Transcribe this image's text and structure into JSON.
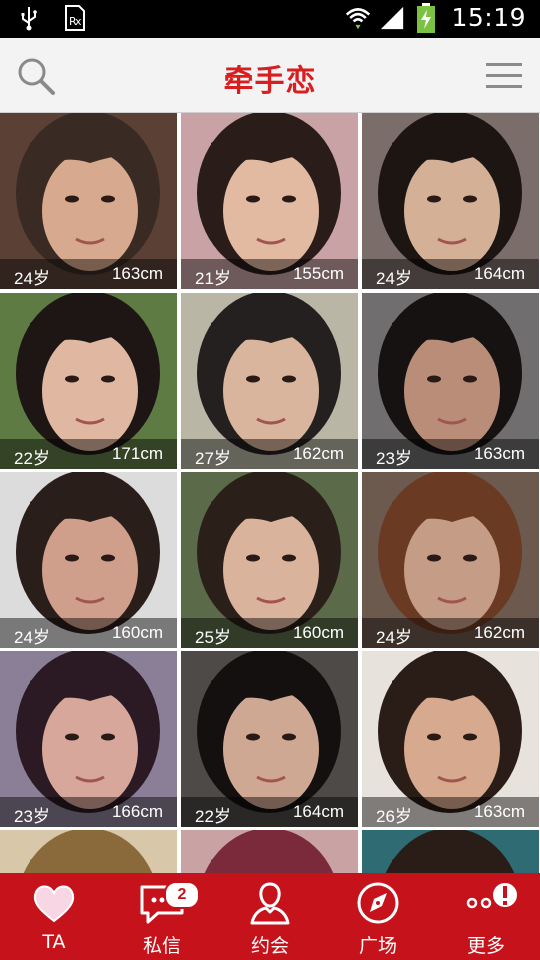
{
  "status_bar": {
    "time": "15:19",
    "icons": [
      "usb-icon",
      "sim-icon",
      "wifi-icon",
      "signal-icon",
      "battery-charging-icon"
    ]
  },
  "header": {
    "title": "牵手恋",
    "search_icon": "search-icon",
    "menu_icon": "hamburger-menu-icon"
  },
  "profiles": [
    {
      "age": "24岁",
      "height": "163cm",
      "palette": [
        "#5a4035",
        "#d7a98e",
        "#3a2a24"
      ]
    },
    {
      "age": "21岁",
      "height": "155cm",
      "palette": [
        "#c9a2a6",
        "#e2b9a1",
        "#2a1c18"
      ]
    },
    {
      "age": "24岁",
      "height": "164cm",
      "palette": [
        "#7b6d6a",
        "#d4b097",
        "#1d1512"
      ]
    },
    {
      "age": "22岁",
      "height": "171cm",
      "palette": [
        "#5f7b44",
        "#e0b8a2",
        "#1e1614"
      ]
    },
    {
      "age": "27岁",
      "height": "162cm",
      "palette": [
        "#b9b6a6",
        "#d8b59c",
        "#252020"
      ]
    },
    {
      "age": "23岁",
      "height": "163cm",
      "palette": [
        "#706e6e",
        "#b98d78",
        "#161212"
      ]
    },
    {
      "age": "24岁",
      "height": "160cm",
      "palette": [
        "#dcdcdc",
        "#d09f8c",
        "#2a1e1a"
      ]
    },
    {
      "age": "25岁",
      "height": "160cm",
      "palette": [
        "#5b6b4a",
        "#d9b39c",
        "#2b1f1a"
      ]
    },
    {
      "age": "24岁",
      "height": "162cm",
      "palette": [
        "#6c5a4e",
        "#c59c85",
        "#6b3a22"
      ]
    },
    {
      "age": "23岁",
      "height": "166cm",
      "palette": [
        "#8a7f96",
        "#d6a79a",
        "#2b1a24"
      ]
    },
    {
      "age": "22岁",
      "height": "164cm",
      "palette": [
        "#4e4a48",
        "#cfa894",
        "#141010"
      ]
    },
    {
      "age": "26岁",
      "height": "163cm",
      "palette": [
        "#e8e2dc",
        "#d7a98e",
        "#2a1c16"
      ]
    },
    {
      "age": "",
      "height": "",
      "palette": [
        "#d9c7a9",
        "#cda88a",
        "#8a6a3a"
      ]
    },
    {
      "age": "",
      "height": "",
      "palette": [
        "#c9a3a3",
        "#d6a890",
        "#7a2a3a"
      ]
    },
    {
      "age": "",
      "height": "",
      "palette": [
        "#2e6b72",
        "#d3a98e",
        "#2a1c16"
      ]
    }
  ],
  "bottom_nav": [
    {
      "label": "TA",
      "icon": "heart-icon"
    },
    {
      "label": "私信",
      "icon": "message-icon",
      "badge": "2"
    },
    {
      "label": "约会",
      "icon": "person-icon"
    },
    {
      "label": "广场",
      "icon": "compass-icon"
    },
    {
      "label": "更多",
      "icon": "more-icon"
    }
  ]
}
